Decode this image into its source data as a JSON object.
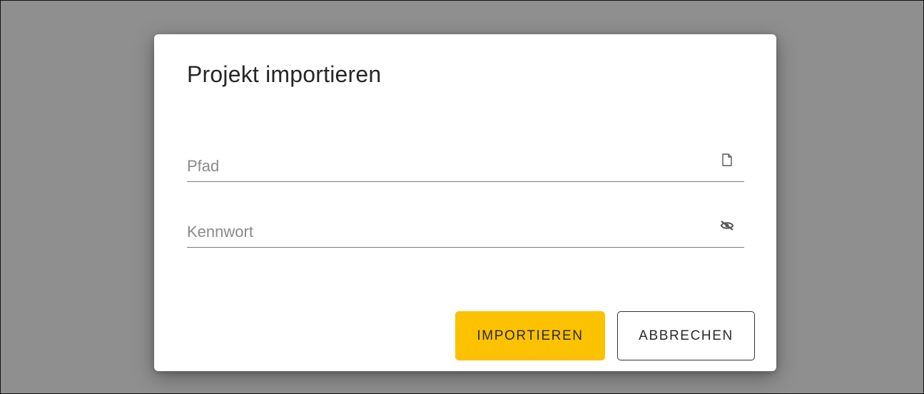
{
  "dialog": {
    "title": "Projekt importieren",
    "fields": {
      "path": {
        "placeholder": "Pfad",
        "value": "",
        "icon": "file-icon"
      },
      "password": {
        "placeholder": "Kennwort",
        "value": "",
        "icon": "eye-off-icon"
      }
    },
    "buttons": {
      "import_label": "IMPORTIEREN",
      "cancel_label": "ABBRECHEN"
    }
  },
  "colors": {
    "backdrop": "#8f8f8f",
    "primary_button": "#fcc200",
    "dialog_background": "#ffffff"
  }
}
